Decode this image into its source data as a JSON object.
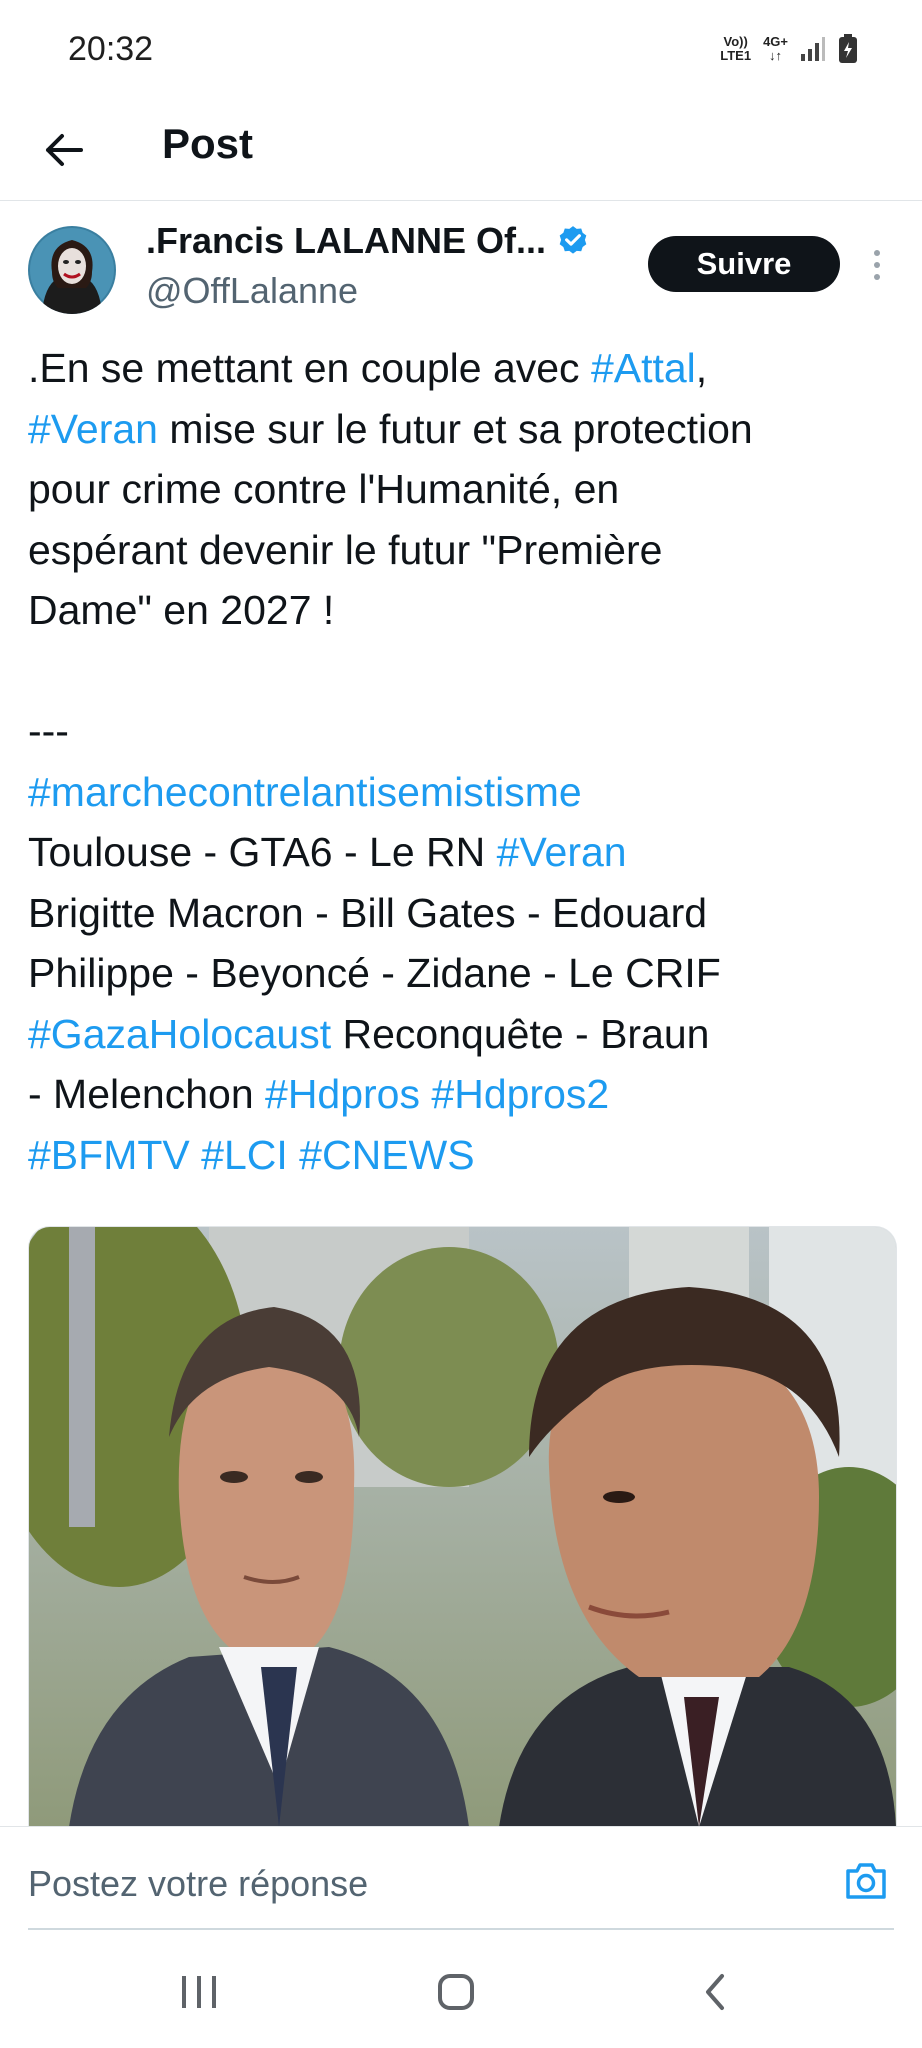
{
  "status_bar": {
    "time": "20:32",
    "volte_top": "Vo))",
    "volte_bottom": "LTE1",
    "network": "4G+",
    "network_arrows": "↓↑"
  },
  "header": {
    "title": "Post",
    "back_icon": "arrow-left-icon"
  },
  "post": {
    "author_name": ".Francis LALANNE Of...",
    "verified": true,
    "handle": "@OffLalanne",
    "follow_label": "Suivre",
    "text": {
      "l1a": ".En se mettant en couple avec ",
      "l1tag": "#Attal",
      "l1b": ",",
      "l2tag": "#Veran",
      "l2b": " mise sur le futur et sa protection",
      "l3": "pour crime contre l'Humanité, en",
      "l4": "espérant devenir le futur \"Première",
      "l5": "Dame\" en 2027 !",
      "l7": "---",
      "l8tag": "#marchecontrelantisemistisme",
      "l9a": "Toulouse - GTA6 - Le RN ",
      "l9tag": "#Veran",
      "l10": "Brigitte Macron - Bill Gates - Edouard",
      "l11": "Philippe - Beyoncé - Zidane - Le CRIF",
      "l12tag": "#GazaHolocaust",
      "l12b": " Reconquête - Braun",
      "l13a": "- Melenchon ",
      "l13tag1": "#Hdpros",
      "l13sp": " ",
      "l13tag2": "#Hdpros2",
      "l14tag1": "#BFMTV",
      "l14sp1": " ",
      "l14tag2": "#LCI",
      "l14sp2": " ",
      "l14tag3": "#CNEWS"
    },
    "colors": {
      "hashtag": "#1d9bf0",
      "text": "#0f1419",
      "secondary": "#536471",
      "verified": "#1d9bf0"
    }
  },
  "reply": {
    "placeholder": "Postez votre réponse",
    "camera_icon": "camera-icon"
  },
  "nav": {
    "icons": [
      "recents-icon",
      "home-icon",
      "back-icon"
    ]
  }
}
